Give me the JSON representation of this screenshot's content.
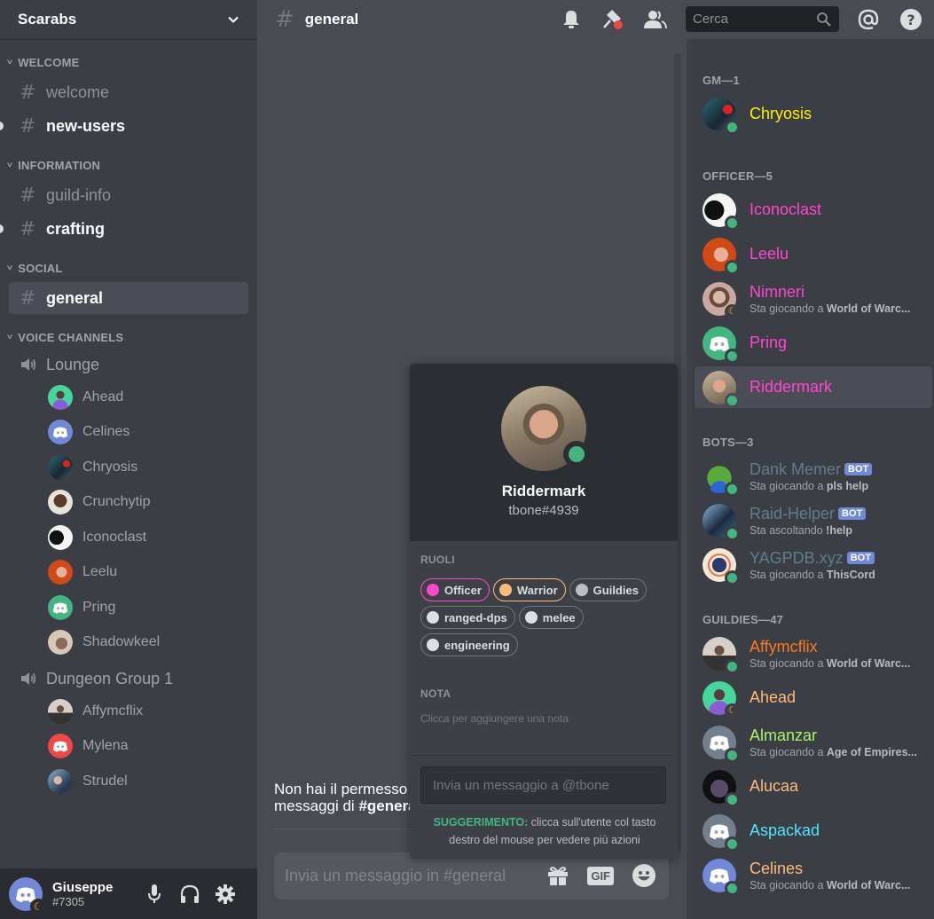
{
  "server": {
    "name": "Scarabs"
  },
  "sidebar": {
    "categories": [
      {
        "label": "WELCOME",
        "channels": [
          {
            "name": "welcome",
            "state": "read"
          },
          {
            "name": "new-users",
            "state": "unread"
          }
        ]
      },
      {
        "label": "INFORMATION",
        "channels": [
          {
            "name": "guild-info",
            "state": "read"
          },
          {
            "name": "crafting",
            "state": "unread"
          }
        ]
      },
      {
        "label": "SOCIAL",
        "channels": [
          {
            "name": "general",
            "state": "active"
          }
        ]
      }
    ],
    "voice_category": "VOICE CHANNELS",
    "voice_channels": [
      {
        "name": "Lounge",
        "users": [
          "Ahead",
          "Celines",
          "Chryosis",
          "Crunchytip",
          "Iconoclast",
          "Leelu",
          "Pring",
          "Shadowkeel"
        ]
      },
      {
        "name": "Dungeon Group 1",
        "users": [
          "Affymcflix",
          "Mylena",
          "Strudel"
        ]
      }
    ]
  },
  "user_panel": {
    "name": "Giuseppe",
    "tag": "#7305",
    "status": "idle"
  },
  "header": {
    "channel": "general",
    "search_placeholder": "Cerca",
    "icons": [
      "bell-icon",
      "pin-icon",
      "members-icon",
      "search-icon",
      "mention-icon",
      "help-icon"
    ]
  },
  "main": {
    "no_permission_line1": "Non hai il permesso",
    "no_permission_line2_prefix": "messaggi di ",
    "no_permission_line2_channel": "#general",
    "composer_placeholder": "Invia un messaggio in #general",
    "gif_label": "GIF"
  },
  "popout": {
    "name": "Riddermark",
    "tag": "tbone#4939",
    "status": "online",
    "roles_label": "RUOLI",
    "roles": [
      {
        "name": "Officer",
        "color": "#ff47ce"
      },
      {
        "name": "Warrior",
        "color": "#ffbb7a"
      },
      {
        "name": "Guildies",
        "color": "#b9bfc4"
      },
      {
        "name": "ranged-dps",
        "color": "#dcdfe6"
      },
      {
        "name": "melee",
        "color": "#dcdfe6"
      },
      {
        "name": "engineering",
        "color": "#dcdfe6"
      }
    ],
    "note_label": "NOTA",
    "note_placeholder": "Clicca per aggiungere una nota",
    "message_placeholder": "Invia un messaggio a @tbone",
    "tip_label": "SUGGERIMENTO:",
    "tip_text": " clicca sull'utente col tasto destro del mouse per vedere più azioni"
  },
  "members": {
    "groups": [
      {
        "label": "GM—1",
        "members": [
          {
            "name": "Chryosis",
            "color": "#fff200",
            "status": "online"
          }
        ]
      },
      {
        "label": "OFFICER—5",
        "members": [
          {
            "name": "Iconoclast",
            "color": "#ff47ce",
            "status": "online"
          },
          {
            "name": "Leelu",
            "color": "#ff47ce",
            "status": "online"
          },
          {
            "name": "Nimneri",
            "color": "#ff47ce",
            "status": "idle",
            "activity_prefix": "Sta giocando a ",
            "activity": "World of Warc..."
          },
          {
            "name": "Pring",
            "color": "#ff47ce",
            "status": "online"
          },
          {
            "name": "Riddermark",
            "color": "#ff47ce",
            "status": "online",
            "selected": true
          }
        ]
      },
      {
        "label": "BOTS—3",
        "members": [
          {
            "name": "Dank Memer",
            "color": "#607d8b",
            "status": "online",
            "bot": "BOT",
            "activity_prefix": "Sta giocando a ",
            "activity": "pls help"
          },
          {
            "name": "Raid-Helper",
            "color": "#607d8b",
            "status": "online",
            "bot": "BOT",
            "activity_prefix": "Sta ascoltando ",
            "activity": "!help"
          },
          {
            "name": "YAGPDB.xyz",
            "color": "#607d8b",
            "status": "online",
            "bot": "BOT",
            "activity_prefix": "Sta giocando a ",
            "activity": "ThisCord"
          }
        ]
      },
      {
        "label": "GUILDIES—47",
        "members": [
          {
            "name": "Affymcflix",
            "color": "#ff7a1a",
            "status": "online",
            "activity_prefix": "Sta giocando a ",
            "activity": "World of Warc..."
          },
          {
            "name": "Ahead",
            "color": "#ffbb7a",
            "status": "idle"
          },
          {
            "name": "Almanzar",
            "color": "#a8f56b",
            "status": "online",
            "activity_prefix": "Sta giocando a ",
            "activity": "Age of Empires..."
          },
          {
            "name": "Alucaa",
            "color": "#ffbb7a",
            "status": "online"
          },
          {
            "name": "Aspackad",
            "color": "#4ee6ff",
            "status": "online"
          },
          {
            "name": "Celines",
            "color": "#ffbb7a",
            "status": "online",
            "activity_prefix": "Sta giocando a ",
            "activity": "World of Warc..."
          }
        ]
      }
    ]
  },
  "colors": {
    "online": "#43b581",
    "idle": "#faa61a",
    "blurple": "#7289da",
    "accent_green": "#43b581"
  }
}
